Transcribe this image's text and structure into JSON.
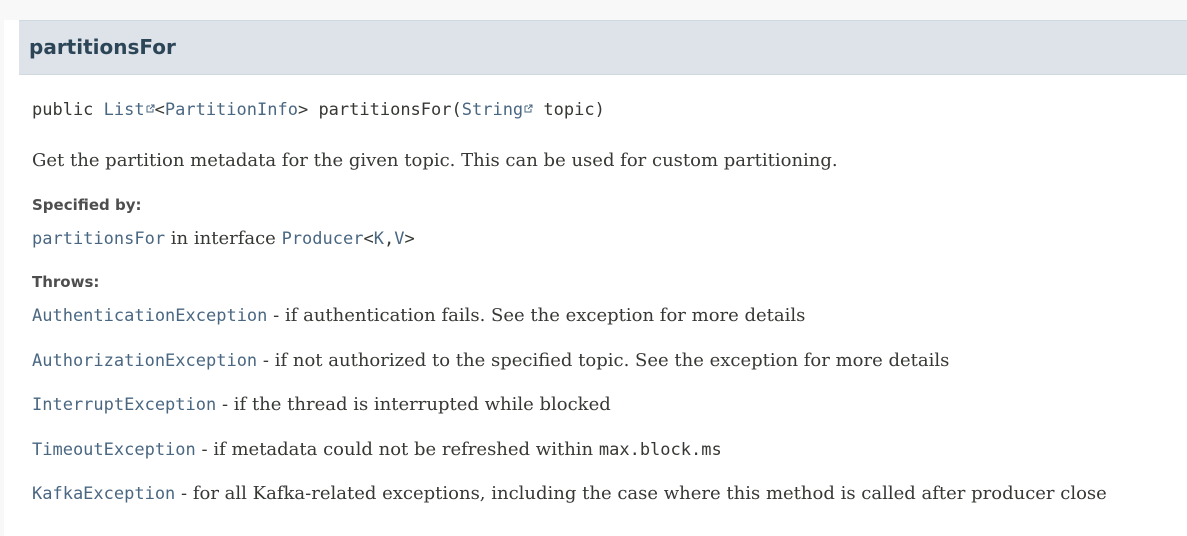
{
  "method": {
    "title": "partitionsFor"
  },
  "signature": {
    "modifier": "public",
    "return_type": "List",
    "type_param": "PartitionInfo",
    "name": "partitionsFor",
    "param_type": "String",
    "param_name": "topic"
  },
  "description": "Get the partition metadata for the given topic. This can be used for custom partitioning.",
  "specified_by": {
    "label": "Specified by:",
    "method": "partitionsFor",
    "text": "in interface",
    "interface": "Producer",
    "type_params": [
      "K",
      "V"
    ]
  },
  "throws": {
    "label": "Throws:",
    "items": [
      {
        "exception": "AuthenticationException",
        "text": "if authentication fails. See the exception for more details"
      },
      {
        "exception": "AuthorizationException",
        "text": "if not authorized to the specified topic. See the exception for more details"
      },
      {
        "exception": "InterruptException",
        "text": "if the thread is interrupted while blocked"
      },
      {
        "exception": "TimeoutException",
        "text": "if metadata could not be refreshed within",
        "code": "max.block.ms"
      },
      {
        "exception": "KafkaException",
        "text": "for all Kafka-related exceptions, including the case where this method is called after producer close"
      }
    ]
  },
  "icons": {
    "external_link": "external-link-icon"
  },
  "colors": {
    "link": "#4a6782",
    "header_bg": "#dee3e9",
    "text": "#353833"
  }
}
